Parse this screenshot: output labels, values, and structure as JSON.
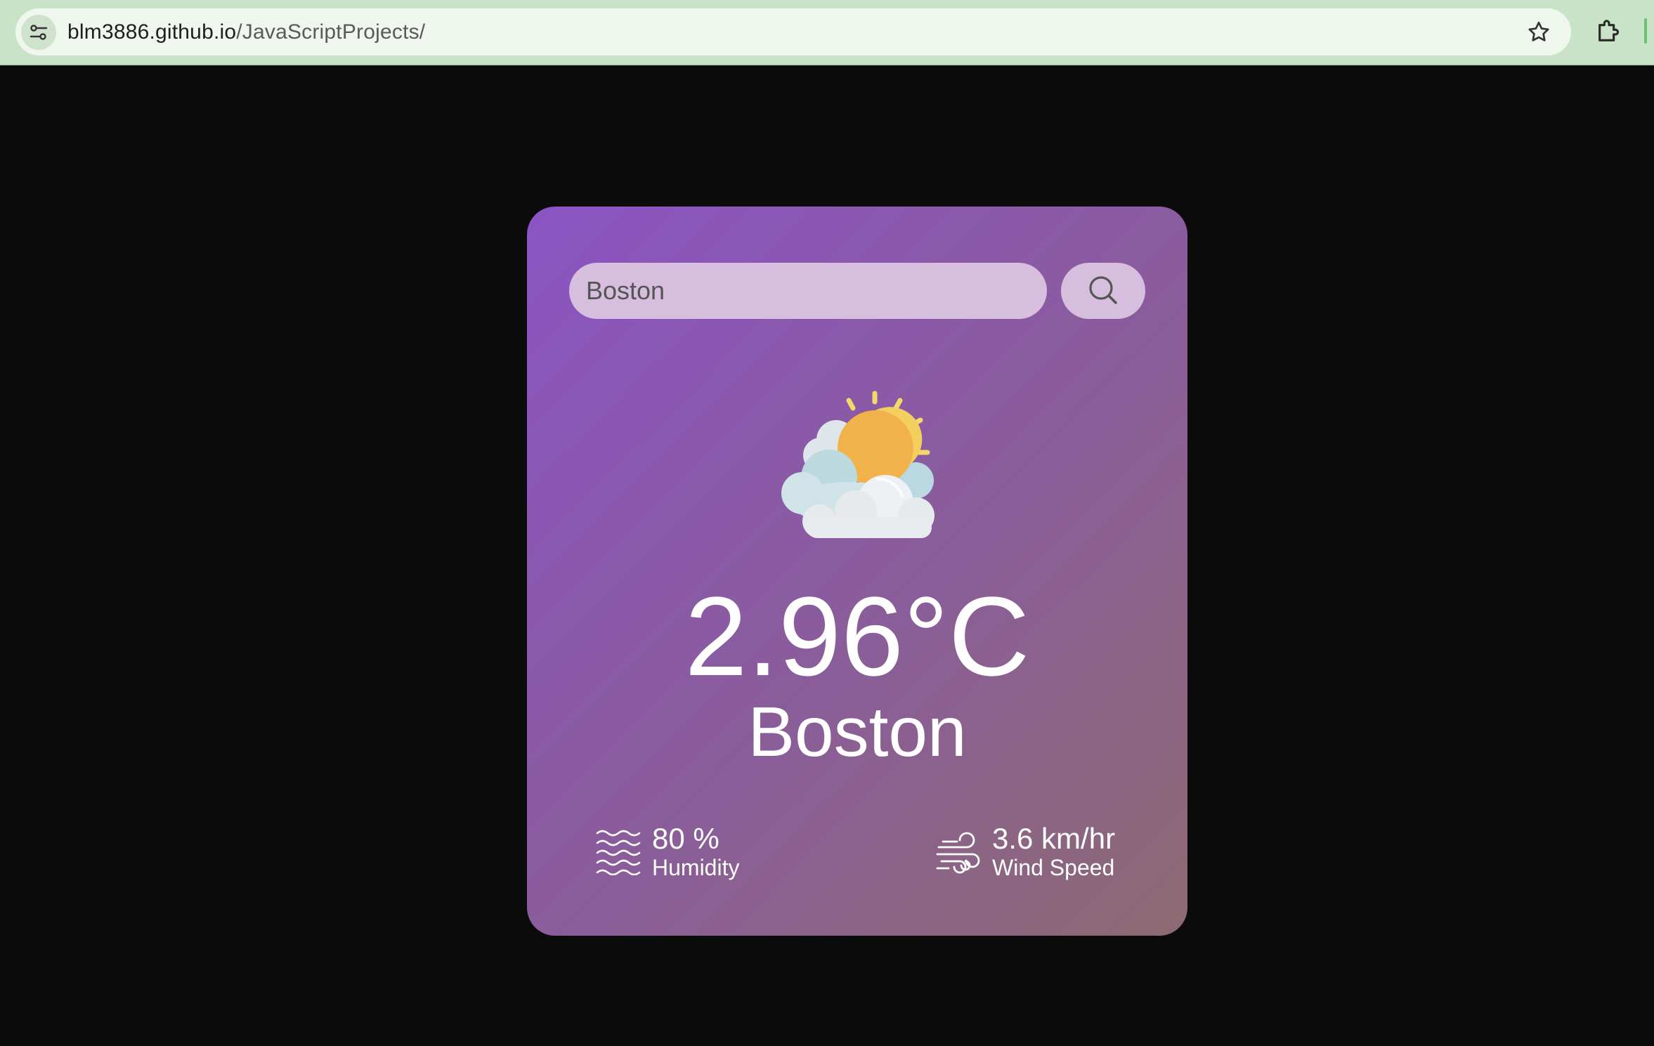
{
  "browser": {
    "url_host": "blm3886.github.io",
    "url_path": "/JavaScriptProjects/",
    "site_info_icon": "tune-icon",
    "bookmark_icon": "star-icon",
    "extensions_icon": "puzzle-icon"
  },
  "weather": {
    "search": {
      "value": "Boston",
      "button_icon": "search-icon"
    },
    "condition_icon": "partly-cloudy-sun-icon",
    "temperature": "2.96°C",
    "city": "Boston",
    "humidity": {
      "value": "80 %",
      "label": "Humidity",
      "icon": "humidity-waves-icon"
    },
    "wind": {
      "value": "3.6 km/hr",
      "label": "Wind Speed",
      "icon": "wind-icon"
    }
  },
  "colors": {
    "page_background": "#0b0b0b",
    "browser_bar": "#c9e3c6",
    "card_gradient_start": "#8a55c4",
    "card_gradient_end": "#8d6a72",
    "search_field": "#d7bedf"
  }
}
